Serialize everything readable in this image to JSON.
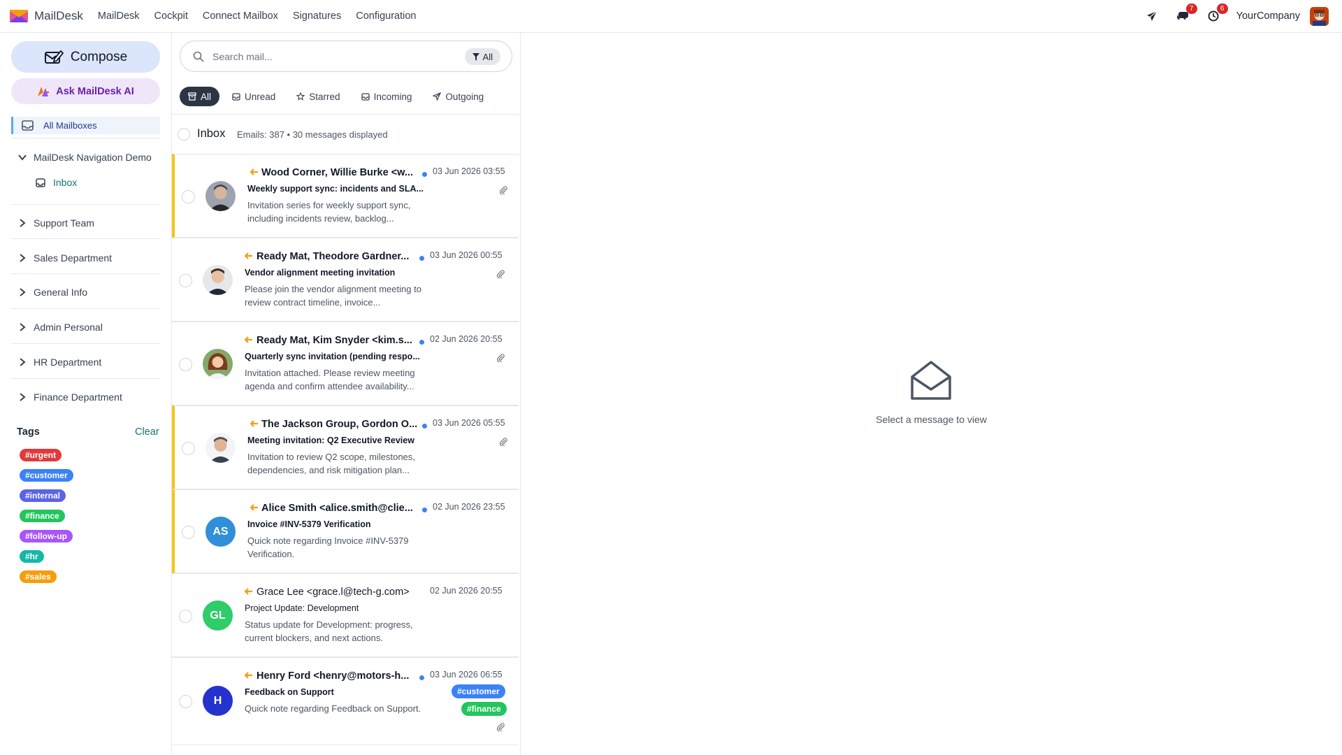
{
  "app": {
    "name": "MailDesk"
  },
  "topmenu": [
    "MailDesk",
    "Cockpit",
    "Connect Mailbox",
    "Signatures",
    "Configuration"
  ],
  "topright": {
    "messages_badge": "7",
    "activity_badge": "6",
    "company": "YourCompany"
  },
  "sidebar": {
    "compose_label": "Compose",
    "ai_label": "Ask MailDesk AI",
    "all_mailboxes_label": "All Mailboxes",
    "expanded_group": "MailDesk Navigation Demo",
    "inbox_label": "Inbox",
    "groups": [
      "Support Team",
      "Sales Department",
      "General Info",
      "Admin Personal",
      "HR Department",
      "Finance Department"
    ],
    "tags_title": "Tags",
    "tags_clear": "Clear",
    "tags": [
      {
        "label": "#urgent",
        "color": "#e03a3a"
      },
      {
        "label": "#customer",
        "color": "#3b82f6"
      },
      {
        "label": "#internal",
        "color": "#5b63e6"
      },
      {
        "label": "#finance",
        "color": "#22c55e"
      },
      {
        "label": "#follow-up",
        "color": "#a855f7"
      },
      {
        "label": "#hr",
        "color": "#14b8a6"
      },
      {
        "label": "#sales",
        "color": "#f59e0b"
      }
    ]
  },
  "list": {
    "search_placeholder": "Search mail...",
    "search_filter_label": "All",
    "tabs": [
      "All",
      "Unread",
      "Starred",
      "Incoming",
      "Outgoing"
    ],
    "folder_title": "Inbox",
    "folder_meta": "Emails: 387 • 30 messages displayed",
    "messages": [
      {
        "from": "Wood Corner, Willie Burke <w...",
        "date": "03 Jun 2026 03:55",
        "subject": "Weekly support sync: incidents and SLA...",
        "preview": "Invitation series for weekly support sync, including incidents review, backlog...",
        "avatar_initials": "",
        "avatar_color": "#6b7280"
      },
      {
        "from": "Ready Mat, Theodore Gardner...",
        "date": "03 Jun 2026 00:55",
        "subject": "Vendor alignment meeting invitation",
        "preview": "Please join the vendor alignment meeting to review contract timeline, invoice...",
        "avatar_initials": "",
        "avatar_color": "#9ca3af"
      },
      {
        "from": "Ready Mat, Kim Snyder <kim.s...",
        "date": "02 Jun 2026 20:55",
        "subject": "Quarterly sync invitation (pending respo...",
        "preview": "Invitation attached. Please review meeting agenda and confirm attendee availability...",
        "avatar_initials": "",
        "avatar_color": "#a3a3a3"
      },
      {
        "from": "The Jackson Group, Gordon O...",
        "date": "03 Jun 2026 05:55",
        "subject": "Meeting invitation: Q2 Executive Review",
        "preview": "Invitation to review Q2 scope, milestones, dependencies, and risk mitigation plan...",
        "avatar_initials": "",
        "avatar_color": "#8b8b8b"
      },
      {
        "from": "Alice Smith <alice.smith@clie...",
        "date": "02 Jun 2026 23:55",
        "subject": "Invoice #INV-5379 Verification",
        "preview": "Quick note regarding Invoice #INV-5379 Verification.",
        "avatar_initials": "AS",
        "avatar_color": "#2f8fd8"
      },
      {
        "from": "Grace Lee <grace.l@tech-g.com>",
        "date": "02 Jun 2026 20:55",
        "subject": "Project Update: Development",
        "preview": "Status update for Development: progress, current blockers, and next actions.",
        "avatar_initials": "GL",
        "avatar_color": "#2fcc6a"
      },
      {
        "from": "Henry Ford <henry@motors-h...",
        "date": "03 Jun 2026 06:55",
        "subject": "Feedback on Support",
        "preview": "Quick note regarding Feedback on Support.",
        "avatar_initials": "H",
        "avatar_color": "#2433cf",
        "tags": [
          "#customer",
          "#finance"
        ]
      }
    ]
  },
  "reading": {
    "empty_text": "Select a message to view"
  }
}
